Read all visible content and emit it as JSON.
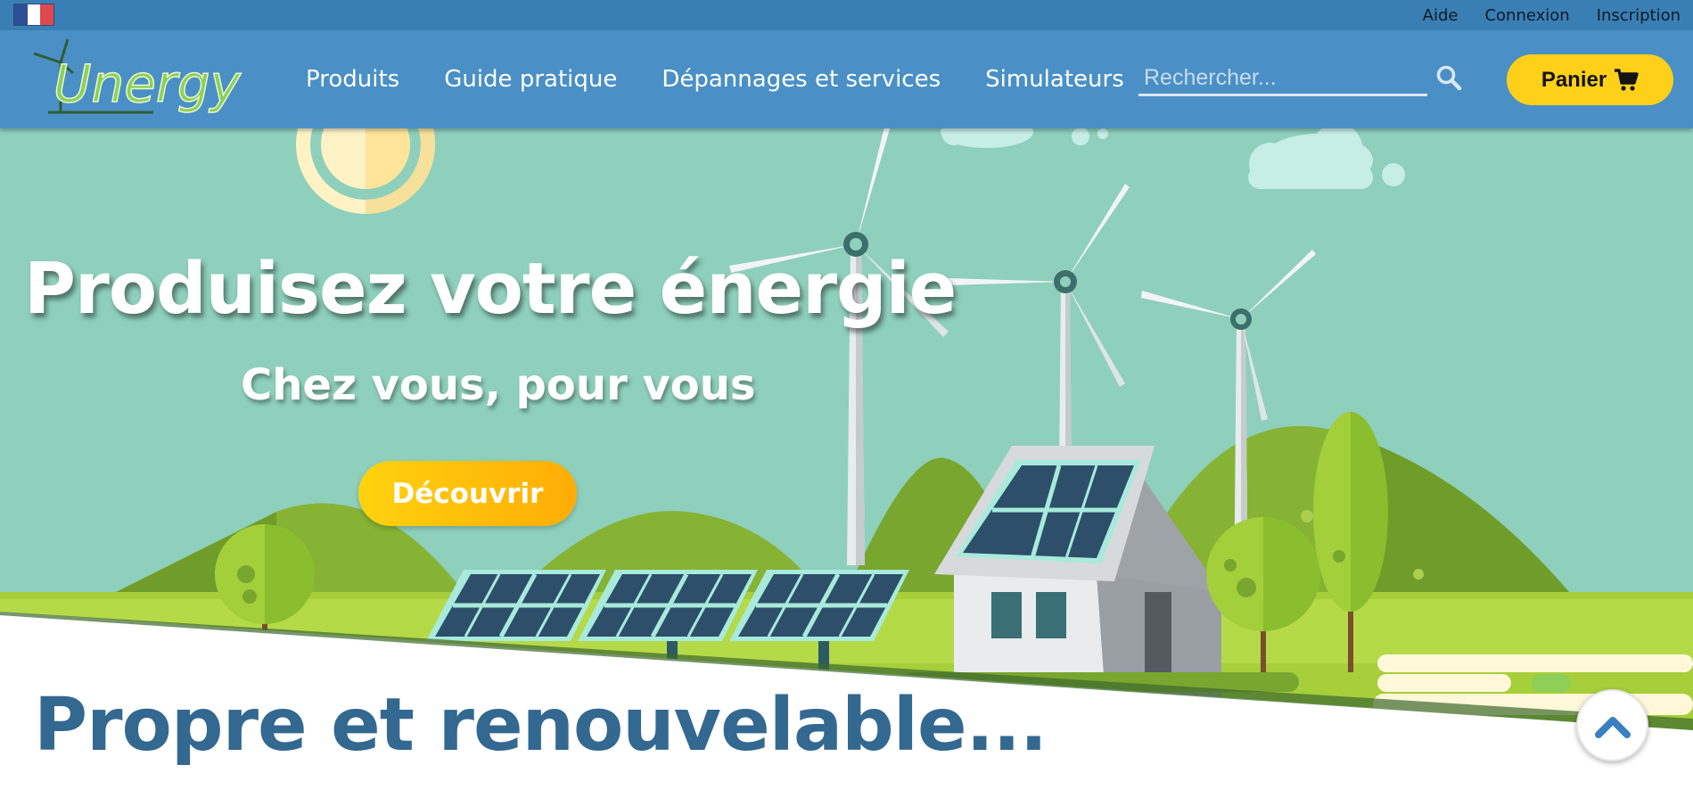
{
  "topbar": {
    "language_flag": "flag-fr",
    "links": [
      "Aide",
      "Connexion",
      "Inscription"
    ]
  },
  "logo": {
    "text": "Unergy",
    "colors": {
      "primary": "#8dcf57",
      "secondary": "#d3f0a6",
      "wind": "#2e5e32"
    }
  },
  "nav": {
    "items": [
      "Produits",
      "Guide pratique",
      "Dépannages et services",
      "Simulateurs"
    ]
  },
  "search": {
    "placeholder": "Rechercher...",
    "icon": "search-icon"
  },
  "cart": {
    "label": "Panier",
    "icon": "cart-icon"
  },
  "hero": {
    "title": "Produisez votre énergie",
    "subtitle": "Chez vous, pour vous",
    "cta_label": "Découvrir"
  },
  "section": {
    "title": "Propre et renouvelable..."
  },
  "scroll_top": {
    "icon": "chevron-up-icon"
  },
  "colors": {
    "topbar": "#3a7fb4",
    "navbar": "#4a90c6",
    "sky": "#8ed0bb",
    "cta": "#ffd20f",
    "section_title": "#336890",
    "grass": "#a6cf3a"
  }
}
